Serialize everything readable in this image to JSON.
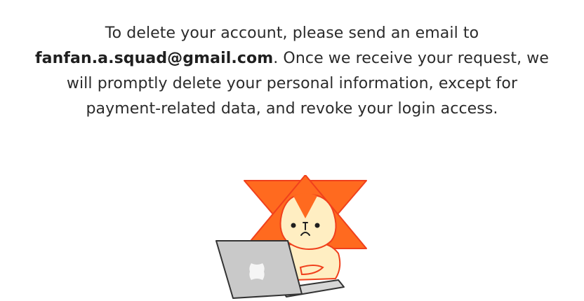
{
  "notice": {
    "line1": "To delete your account, please send an email to",
    "email": "fanfan.a.squad@gmail.com",
    "line2_rest": ". Once we receive your request, we",
    "line3": "will promptly delete your personal information, except for",
    "line4": "payment-related data, and revoke your login access."
  },
  "illustration": {
    "subject": "mascot-at-laptop",
    "colors": {
      "star": "#ff6a1f",
      "star_outline": "#f0401c",
      "face": "#ffeec2",
      "laptop": "#c9c9c9",
      "laptop_outline": "#333333"
    }
  }
}
